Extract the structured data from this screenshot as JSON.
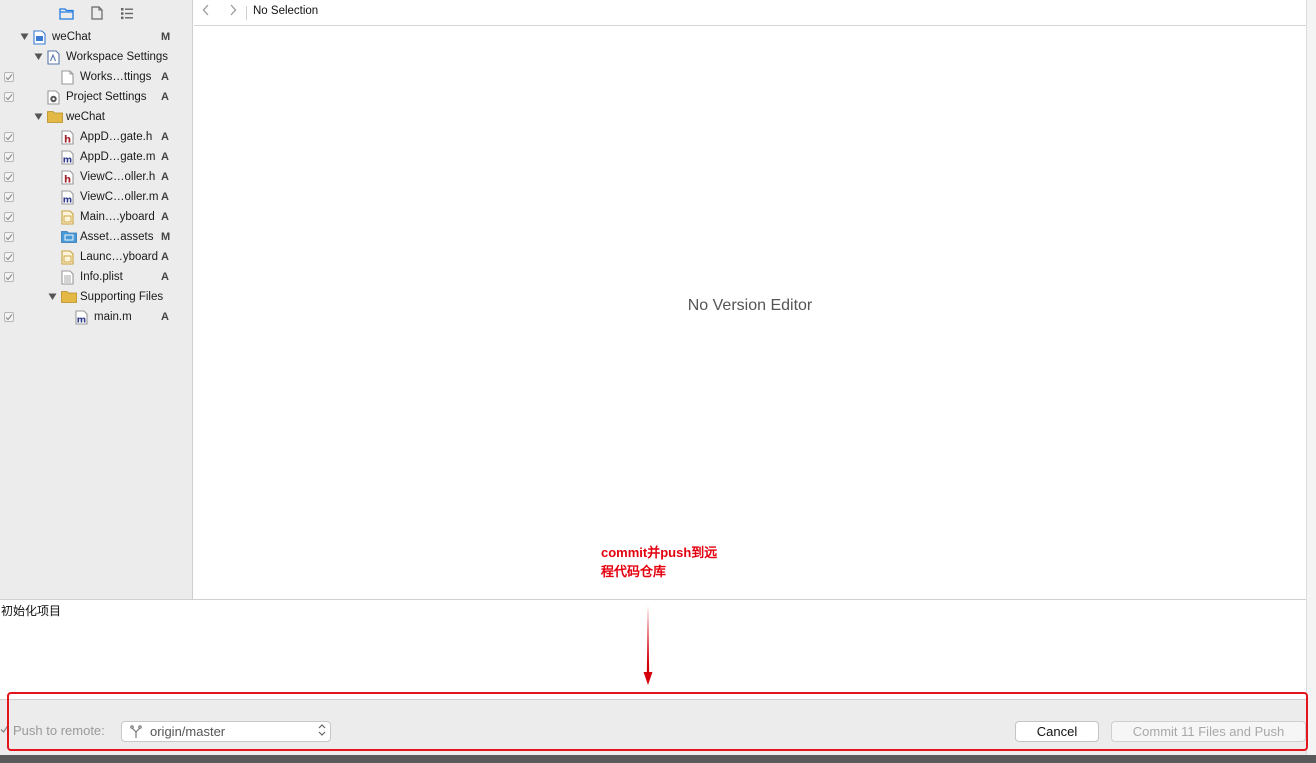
{
  "sidebar": {
    "toolbar": {
      "icons": [
        "folder-icon",
        "document-icon",
        "list-icon"
      ]
    },
    "tree": [
      {
        "label": "weChat",
        "status": "M",
        "icon": "project-icon",
        "level": 0,
        "disclosure": "open",
        "checkbox": false
      },
      {
        "label": "Workspace Settings",
        "status": "",
        "icon": "workspace-icon",
        "level": 1,
        "disclosure": "open",
        "checkbox": false
      },
      {
        "label": "Works…ttings",
        "status": "A",
        "icon": "blank-file-icon",
        "level": 2,
        "disclosure": "",
        "checkbox": true
      },
      {
        "label": "Project Settings",
        "status": "A",
        "icon": "gear-file-icon",
        "level": 1,
        "disclosure": "",
        "checkbox": true
      },
      {
        "label": "weChat",
        "status": "",
        "icon": "folder-icon",
        "level": 1,
        "disclosure": "open",
        "checkbox": false
      },
      {
        "label": "AppD…gate.h",
        "status": "A",
        "icon": "h-file-icon",
        "level": 2,
        "disclosure": "",
        "checkbox": true
      },
      {
        "label": "AppD…gate.m",
        "status": "A",
        "icon": "m-file-icon",
        "level": 2,
        "disclosure": "",
        "checkbox": true
      },
      {
        "label": "ViewC…oller.h",
        "status": "A",
        "icon": "h-file-icon",
        "level": 2,
        "disclosure": "",
        "checkbox": true
      },
      {
        "label": "ViewC…oller.m",
        "status": "A",
        "icon": "m-file-icon",
        "level": 2,
        "disclosure": "",
        "checkbox": true
      },
      {
        "label": "Main….yboard",
        "status": "A",
        "icon": "storyboard-icon",
        "level": 2,
        "disclosure": "",
        "checkbox": true
      },
      {
        "label": "Asset…assets",
        "status": "M",
        "icon": "assets-folder-icon",
        "level": 2,
        "disclosure": "",
        "checkbox": true
      },
      {
        "label": "Launc…yboard",
        "status": "A",
        "icon": "storyboard-icon",
        "level": 2,
        "disclosure": "",
        "checkbox": true
      },
      {
        "label": "Info.plist",
        "status": "A",
        "icon": "plist-icon",
        "level": 2,
        "disclosure": "",
        "checkbox": true
      },
      {
        "label": "Supporting Files",
        "status": "",
        "icon": "folder-icon",
        "level": 2,
        "disclosure": "open",
        "checkbox": false
      },
      {
        "label": "main.m",
        "status": "A",
        "icon": "m-file-icon",
        "level": 3,
        "disclosure": "",
        "checkbox": true
      }
    ]
  },
  "editor": {
    "back_label": "<",
    "forward_label": ">",
    "jump_bar": "No Selection",
    "placeholder": "No Version Editor"
  },
  "annotation": {
    "line1": "commit并push到远",
    "line2": "程代码仓库",
    "color": "#e3000f"
  },
  "commit": {
    "message": "初始化项目"
  },
  "bottom": {
    "push_label": "Push to remote:",
    "push_checked": true,
    "remote": "origin/master",
    "cancel_label": "Cancel",
    "commit_label": "Commit 11 Files and Push"
  }
}
